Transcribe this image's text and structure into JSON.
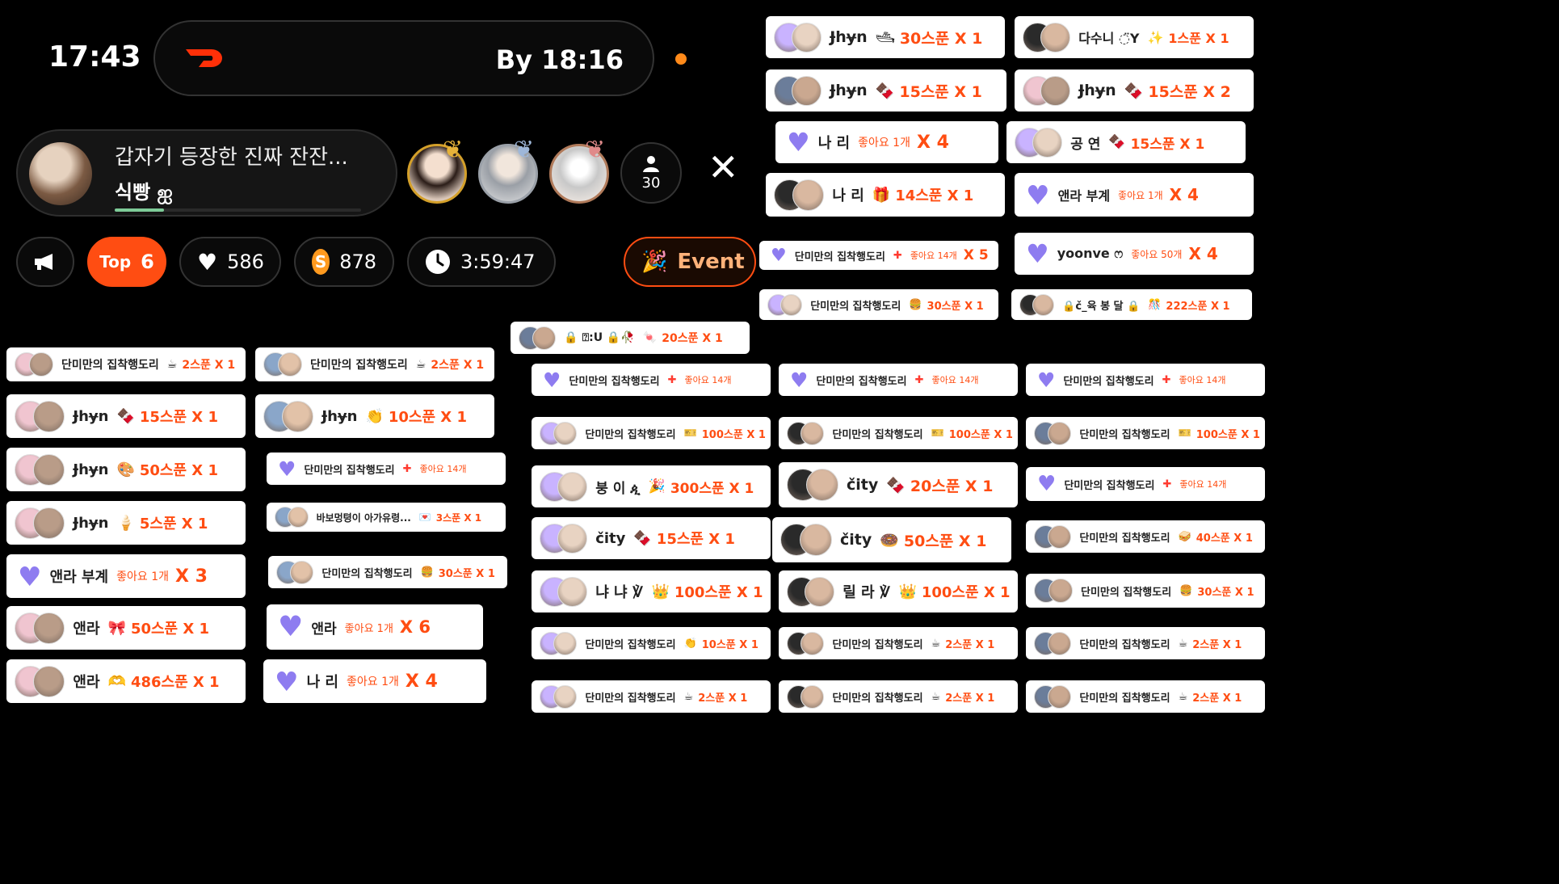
{
  "status": {
    "time": "17:43",
    "eta": "By 18:16"
  },
  "stream": {
    "title": "갑자기 등장한 진짜 잔잔...",
    "host": "식빵 ஐ",
    "progress_fraction": 0.2
  },
  "viewers": {
    "count": "30"
  },
  "stats": {
    "top_label": "Top",
    "top_value": "6",
    "likes": "586",
    "coins": "878",
    "coin_glyph": "S",
    "duration": "3:59:47",
    "event": "Event"
  },
  "colors": {
    "accent": "#ff4d12",
    "amount": "#ff4d12",
    "heart": "#8e7cf0",
    "dot": "#ff8a1a"
  },
  "tiles": [
    {
      "name": "Ɉhɏn",
      "icon": "🛥",
      "amount": "30스푼 X 1"
    },
    {
      "name": "다수니 ◌̈Y",
      "icon": "✨",
      "amount": "1스푼 X 1"
    },
    {
      "name": "Ɉhɏn",
      "icon": "🍫",
      "amount": "15스푼 X 1"
    },
    {
      "name": "Ɉhɏn",
      "icon": "🍫",
      "amount": "15스푼 X 2"
    },
    {
      "name": "나 리",
      "like": "좋아요 1개",
      "mult": "X 4"
    },
    {
      "name": "공   연",
      "icon": "🍫",
      "amount": "15스푼 X 1"
    },
    {
      "name": "나 리",
      "icon": "🎁",
      "amount": "14스푼 X 1"
    },
    {
      "name": "앤라 부계",
      "like": "좋아요 1개",
      "mult": "X 4"
    },
    {
      "name": "단미만의 집착행도리",
      "like": "좋아요 14개",
      "mult": "X 5"
    },
    {
      "name": "yoonve ෆ",
      "like": "좋아요 50개",
      "mult": "X 4"
    },
    {
      "name": "단미만의 집착행도리",
      "icon": "🍔",
      "amount": "30스푼 X 1"
    },
    {
      "name": "🔒č_육 봉 달 🔒",
      "icon": "🎊",
      "amount": "222스푼 X 1"
    },
    {
      "name": "🔒 ⍰:U 🔒🥀",
      "icon": "🍬",
      "amount": "20스푼 X 1"
    },
    {
      "name": "단미만의 집착행도리",
      "icon": "☕",
      "amount": "2스푼 X 1"
    },
    {
      "name": "단미만의 집착행도리",
      "icon": "☕",
      "amount": "2스푼 X 1"
    },
    {
      "name": "단미만의 집착행도리",
      "like": "좋아요 14개"
    },
    {
      "name": "단미만의 집착행도리",
      "like": "좋아요 14개"
    },
    {
      "name": "단미만의 집착행도리",
      "like": "좋아요 14개"
    },
    {
      "name": "Ɉhɏn",
      "icon": "🍫",
      "amount": "15스푼 X 1"
    },
    {
      "name": "Ɉhɏn",
      "icon": "👏",
      "amount": "10스푼 X 1"
    },
    {
      "name": "단미만의 집착행도리",
      "icon": "🎫",
      "amount": "100스푼 X 1"
    },
    {
      "name": "단미만의 집착행도리",
      "icon": "🎫",
      "amount": "100스푼 X 1"
    },
    {
      "name": "단미만의 집착행도리",
      "icon": "🎫",
      "amount": "100스푼 X 1"
    },
    {
      "name": "Ɉhɏn",
      "icon": "🎨",
      "amount": "50스푼 X 1"
    },
    {
      "name": "단미만의 집착행도리",
      "like": "좋아요 14개"
    },
    {
      "name": "붕 이 ዺ",
      "icon": "🎉",
      "amount": "300스푼 X 1"
    },
    {
      "name": "čity",
      "icon": "🍫",
      "amount": "20스푼 X 1"
    },
    {
      "name": "단미만의 집착행도리",
      "like": "좋아요 14개"
    },
    {
      "name": "Ɉhɏn",
      "icon": "🍦",
      "amount": "5스푼 X 1"
    },
    {
      "name": "바보멍텽이 아가유령...",
      "icon": "💌",
      "amount": "3스푼 X 1"
    },
    {
      "name": "čity",
      "icon": "🍫",
      "amount": "15스푼 X 1"
    },
    {
      "name": "čity",
      "icon": "🍩",
      "amount": "50스푼 X 1"
    },
    {
      "name": "단미만의 집착행도리",
      "icon": "🥪",
      "amount": "40스푼 X 1"
    },
    {
      "name": "앤라 부계",
      "like": "좋아요 1개",
      "mult": "X 3"
    },
    {
      "name": "단미만의 집착행도리",
      "icon": "🍔",
      "amount": "30스푼 X 1"
    },
    {
      "name": "냐 냐 ℣",
      "icon": "👑",
      "amount": "100스푼 X 1"
    },
    {
      "name": "릴 라 ℣",
      "icon": "👑",
      "amount": "100스푼 X 1"
    },
    {
      "name": "단미만의 집착행도리",
      "icon": "🍔",
      "amount": "30스푼 X 1"
    },
    {
      "name": "앤라",
      "icon": "🎀",
      "amount": "50스푼 X 1"
    },
    {
      "name": "앤라",
      "like": "좋아요 1개",
      "mult": "X 6"
    },
    {
      "name": "단미만의 집착행도리",
      "icon": "👏",
      "amount": "10스푼 X 1"
    },
    {
      "name": "단미만의 집착행도리",
      "icon": "☕",
      "amount": "2스푼 X 1"
    },
    {
      "name": "단미만의 집착행도리",
      "icon": "☕",
      "amount": "2스푼 X 1"
    },
    {
      "name": "앤라",
      "icon": "🫶",
      "amount": "486스푼 X 1"
    },
    {
      "name": "나 리",
      "like": "좋아요 1개",
      "mult": "X 4"
    },
    {
      "name": "단미만의 집착행도리",
      "icon": "☕",
      "amount": "2스푼 X 1"
    },
    {
      "name": "단미만의 집착행도리",
      "icon": "☕",
      "amount": "2스푼 X 1"
    },
    {
      "name": "단미만의 집착행도리",
      "icon": "☕",
      "amount": "2스푼 X 1"
    }
  ]
}
